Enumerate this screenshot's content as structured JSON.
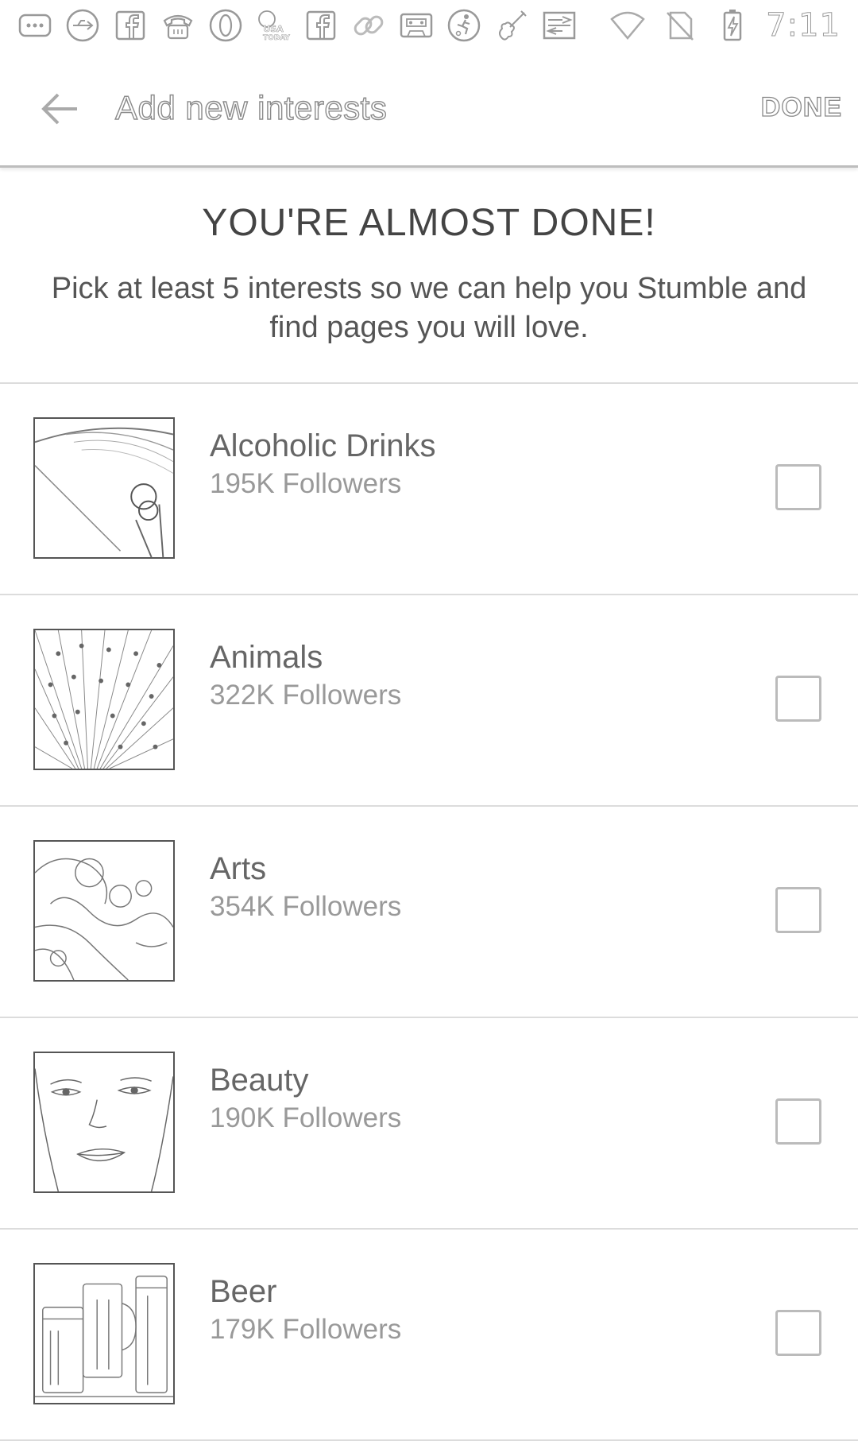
{
  "status_bar": {
    "time": "7:11",
    "icons": [
      "more-icon",
      "usb-icon",
      "facebook-icon",
      "phone-icon",
      "circle-icon",
      "usa-today-icon",
      "facebook-icon",
      "link-icon",
      "cassette-icon",
      "soccer-icon",
      "violin-icon",
      "cast-icon"
    ],
    "usa_today_label": "USA TODAY"
  },
  "app_bar": {
    "title": "Add new interests",
    "done_label": "DONE"
  },
  "intro": {
    "heading": "YOU'RE ALMOST DONE!",
    "text": "Pick at least 5 interests so we can help you Stumble and find pages you will love."
  },
  "interests": [
    {
      "name": "Alcoholic Drinks",
      "followers": "195K Followers",
      "checked": false
    },
    {
      "name": "Animals",
      "followers": "322K Followers",
      "checked": false
    },
    {
      "name": "Arts",
      "followers": "354K Followers",
      "checked": false
    },
    {
      "name": "Beauty",
      "followers": "190K Followers",
      "checked": false
    },
    {
      "name": "Beer",
      "followers": "179K Followers",
      "checked": false
    }
  ]
}
